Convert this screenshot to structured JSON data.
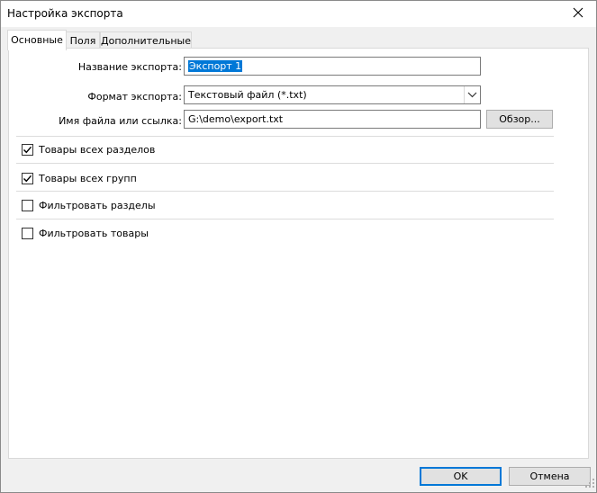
{
  "window": {
    "title": "Настройка экспорта"
  },
  "tabs": [
    {
      "label": "Основные",
      "active": true
    },
    {
      "label": "Поля",
      "active": false
    },
    {
      "label": "Дополнительные",
      "active": false
    }
  ],
  "form": {
    "name_label": "Название экспорта:",
    "name_value": "Экспорт 1",
    "format_label": "Формат экспорта:",
    "format_value": "Текстовый файл (*.txt)",
    "file_label": "Имя файла или ссылка:",
    "file_value": "G:\\demo\\export.txt",
    "browse_label": "Обзор..."
  },
  "checkboxes": [
    {
      "label": "Товары всех разделов",
      "checked": true
    },
    {
      "label": "Товары всех групп",
      "checked": true
    },
    {
      "label": "Фильтровать разделы",
      "checked": false
    },
    {
      "label": "Фильтровать товары",
      "checked": false
    }
  ],
  "footer": {
    "ok_label": "OK",
    "cancel_label": "Отмена"
  },
  "colors": {
    "accent": "#0078d7",
    "face": "#f0f0f0",
    "border": "#adadad"
  }
}
